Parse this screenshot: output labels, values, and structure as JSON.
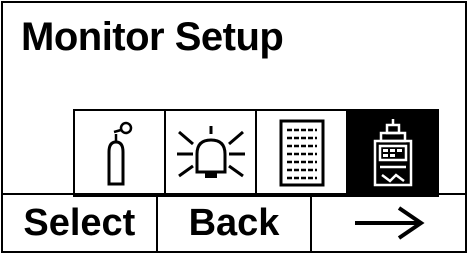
{
  "title": "Monitor Setup",
  "menu_icons": [
    {
      "icon": "gas-cylinder-icon",
      "selected": false
    },
    {
      "icon": "alarm-bell-icon",
      "selected": false
    },
    {
      "icon": "datalog-sheet-icon",
      "selected": false
    },
    {
      "icon": "instrument-settings-icon",
      "selected": true
    }
  ],
  "softkeys": {
    "left": "Select",
    "middle": "Back",
    "right_icon": "right-arrow-icon"
  },
  "colors": {
    "foreground": "#000000",
    "background": "#ffffff",
    "selected_background": "#000000"
  }
}
